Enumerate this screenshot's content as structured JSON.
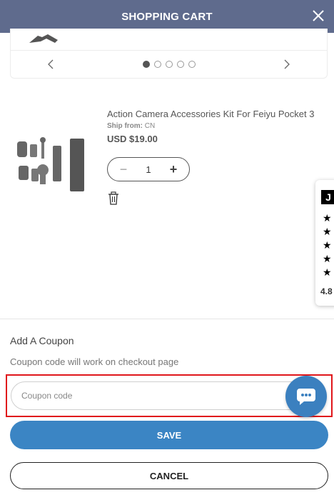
{
  "header": {
    "title": "SHOPPING CART",
    "close_icon": "close-icon"
  },
  "carousel": {
    "prev_icon": "chevron-left-icon",
    "next_icon": "chevron-right-icon",
    "dot_count": 5,
    "active_dot": 1
  },
  "product": {
    "title": "Action Camera Accessories Kit For Feiyu Pocket 3",
    "ship_label": "Ship from:",
    "ship_value": "CN",
    "price": "USD $19.00",
    "quantity": "1",
    "minus_label": "−",
    "plus_label": "+",
    "trash_icon": "trash-icon"
  },
  "reviews": {
    "logo": "J",
    "stars": 5,
    "score": "4.8"
  },
  "coupon": {
    "title": "Add A Coupon",
    "hint": "Coupon code will work on checkout page",
    "placeholder": "Coupon code",
    "value": "",
    "save_label": "SAVE",
    "cancel_label": "CANCEL"
  },
  "colors": {
    "header_bg": "#5f6b8d",
    "save_bg": "#3b85c4",
    "chat_bg": "#3b80bf",
    "highlight_border": "#e0161b"
  }
}
